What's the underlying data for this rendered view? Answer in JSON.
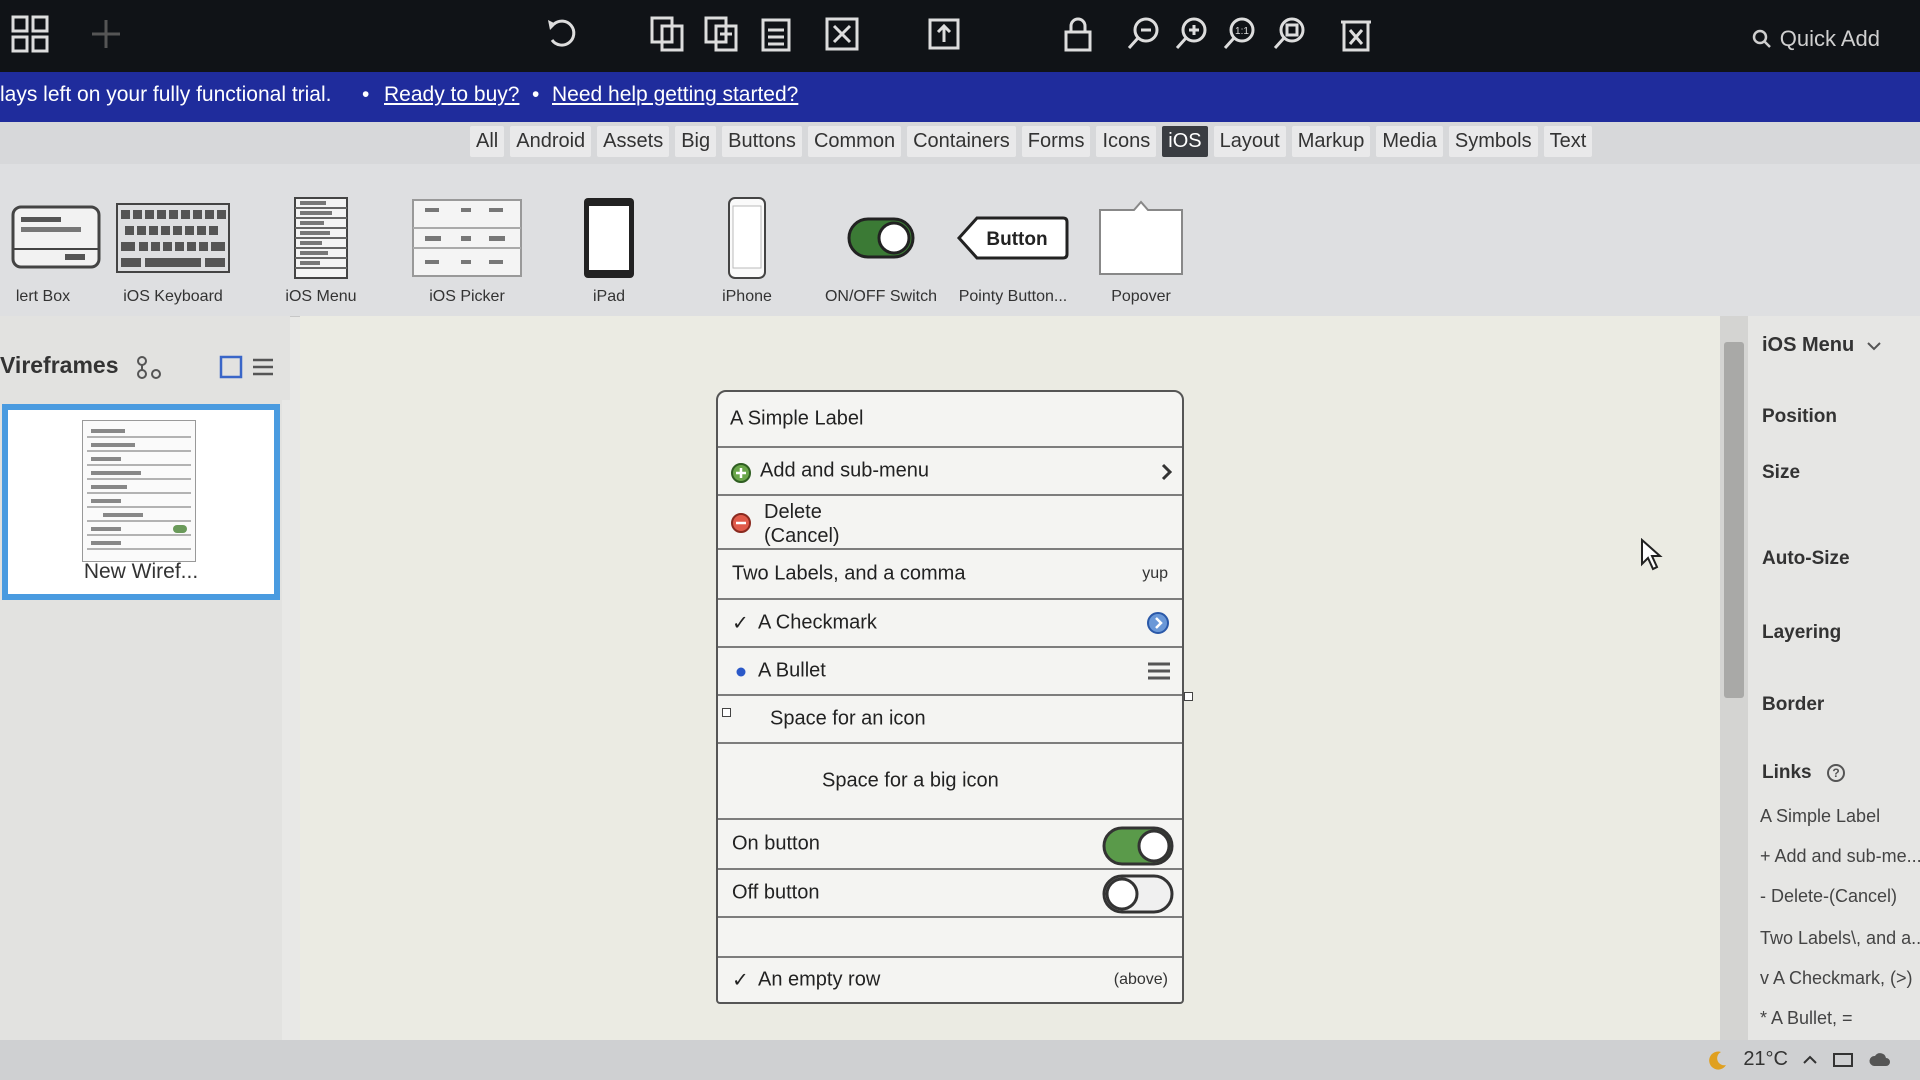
{
  "toolbar": {
    "quick_add_label": "Quick Add",
    "icons": [
      "grid-icon",
      "plus-icon",
      "undo-icon",
      "duplicate-icon",
      "copy-icon",
      "paste-icon",
      "fit-icon",
      "export-icon",
      "lock-icon",
      "zoom-out-icon",
      "zoom-in-icon",
      "zoom-actual-icon",
      "zoom-fit-icon",
      "delete-icon"
    ]
  },
  "banner": {
    "trial_text": "lays left on your fully functional trial.",
    "separator": "•",
    "ready_link": "Ready to buy?",
    "help_link": "Need help getting started?"
  },
  "tabs": {
    "items": [
      "All",
      "Android",
      "Assets",
      "Big",
      "Buttons",
      "Common",
      "Containers",
      "Forms",
      "Icons",
      "iOS",
      "Layout",
      "Markup",
      "Media",
      "Symbols",
      "Text"
    ],
    "active": "iOS"
  },
  "components": [
    {
      "label": "lert Box"
    },
    {
      "label": "iOS Keyboard"
    },
    {
      "label": "iOS Menu"
    },
    {
      "label": "iOS Picker"
    },
    {
      "label": "iPad"
    },
    {
      "label": "iPhone"
    },
    {
      "label": "ON/OFF Switch"
    },
    {
      "label": "Pointy Button..."
    },
    {
      "label": "Popover"
    }
  ],
  "pointy_button_text": "Button",
  "left_panel": {
    "title": "Vireframes",
    "wireframe_name": "New Wiref..."
  },
  "ios_menu": {
    "title": "A Simple Label",
    "add_submenu": "Add and sub-menu",
    "delete_line1": "Delete",
    "delete_line2": "(Cancel)",
    "two_labels": "Two Labels, and a comma",
    "two_labels_right": "yup",
    "checkmark": "A Checkmark",
    "bullet": "A Bullet",
    "space_icon": "Space for an icon",
    "space_big_icon": "Space for a big icon",
    "on_button": "On button",
    "off_button": "Off button",
    "empty_row": "An empty row",
    "empty_row_right": "(above)"
  },
  "right_panel": {
    "header": "iOS Menu",
    "sections": [
      "Position",
      "Size",
      "Auto-Size",
      "Layering",
      "Border"
    ],
    "links_label": "Links",
    "links": [
      "A Simple Label",
      "+ Add and sub-me...",
      "- Delete-(Cancel)",
      "Two Labels\\, and a...",
      "v A Checkmark, (>)",
      "* A Bullet, ="
    ]
  },
  "taskbar": {
    "temperature": "21°C"
  },
  "colors": {
    "banner": "#1f2c9c",
    "toolbar": "#101317",
    "selection": "#4a9be0",
    "switch_on": "#5a9a4a"
  }
}
